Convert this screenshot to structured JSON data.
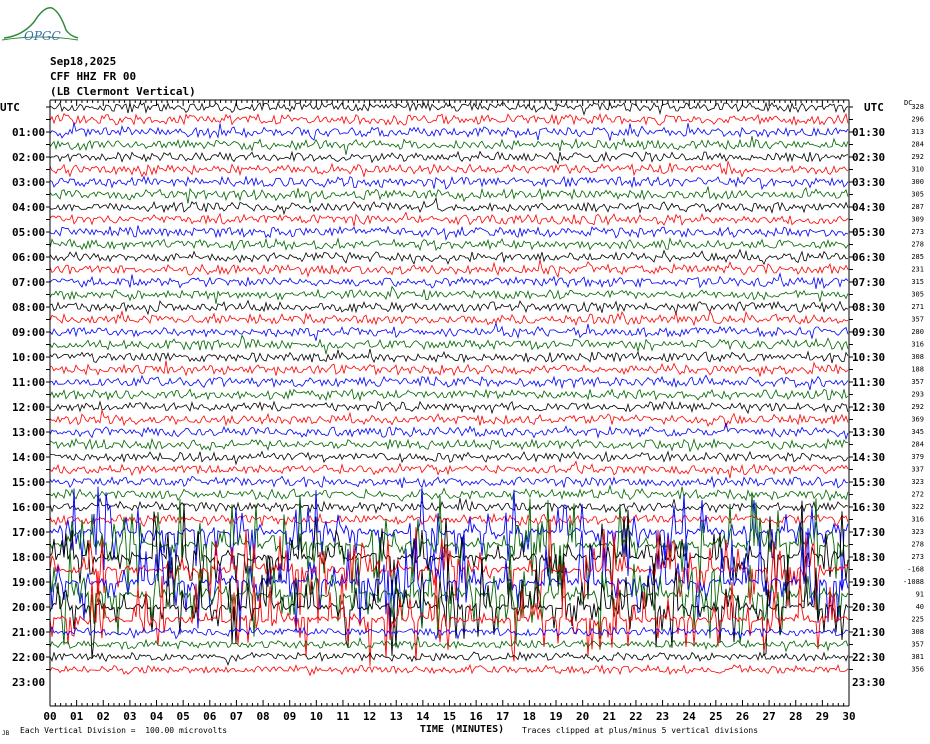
{
  "header": {
    "date": "Sep18,2025",
    "station": "CFF HHZ FR 00",
    "location": "(LB Clermont Vertical)",
    "logo_text": "OPGC"
  },
  "axis": {
    "left_unit": "UTC",
    "right_unit": "UTC",
    "gain_label": "DC",
    "x_label": "TIME (MINUTES)",
    "x_ticks": [
      "00",
      "01",
      "02",
      "03",
      "04",
      "05",
      "06",
      "07",
      "08",
      "09",
      "10",
      "11",
      "12",
      "13",
      "14",
      "15",
      "16",
      "17",
      "18",
      "19",
      "20",
      "21",
      "22",
      "23",
      "24",
      "25",
      "26",
      "27",
      "28",
      "29",
      "30"
    ]
  },
  "footer": {
    "division": "Each Vertical Division =  100.00 microvolts",
    "clip": "Traces clipped at plus/minus 5 vertical divisions",
    "corner": "JB"
  },
  "chart_data": {
    "type": "line",
    "title": "",
    "x_range": [
      0,
      30
    ],
    "trace_minutes": 30,
    "colors": [
      "#000000",
      "#ff0000",
      "#0000ff",
      "#006400"
    ],
    "left_labels": [
      "01:00",
      "02:00",
      "03:00",
      "04:00",
      "05:00",
      "06:00",
      "07:00",
      "08:00",
      "09:00",
      "10:00",
      "11:00",
      "12:00",
      "13:00",
      "14:00",
      "15:00",
      "16:00",
      "17:00",
      "18:00",
      "19:00",
      "20:00",
      "21:00",
      "22:00",
      "23:00"
    ],
    "right_labels": [
      "01:30",
      "02:30",
      "03:30",
      "04:30",
      "05:30",
      "06:30",
      "07:30",
      "08:30",
      "09:30",
      "10:30",
      "11:30",
      "12:30",
      "13:30",
      "14:30",
      "15:30",
      "16:30",
      "17:30",
      "18:30",
      "19:30",
      "20:30",
      "21:30",
      "22:30",
      "23:30"
    ],
    "dc_offsets": [
      "328",
      "296",
      "313",
      "284",
      "292",
      "310",
      "300",
      "305",
      "287",
      "309",
      "273",
      "278",
      "285",
      "231",
      "315",
      "305",
      "271",
      "357",
      "280",
      "316",
      "308",
      "188",
      "357",
      "293",
      "292",
      "369",
      "345",
      "284",
      "379",
      "337",
      "323",
      "272",
      "322",
      "316",
      "323",
      "278",
      "273",
      "-168",
      "-1088",
      "91",
      "40",
      "225",
      "308",
      "357",
      "381",
      "356"
    ],
    "event": {
      "start_trace": 34,
      "end_trace": 41,
      "description_visible": false
    }
  }
}
